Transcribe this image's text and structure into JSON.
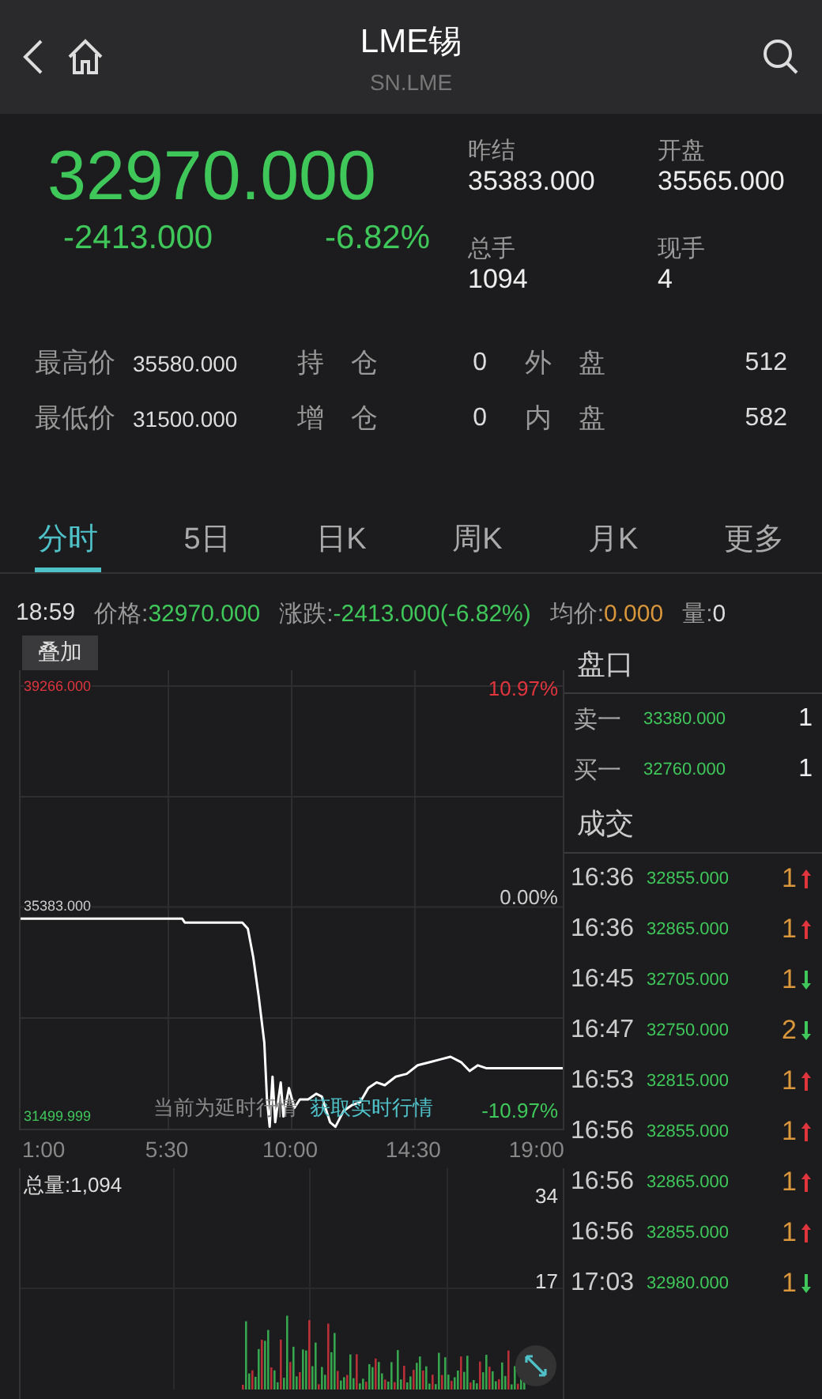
{
  "header": {
    "title": "LME锡",
    "subtitle": "SN.LME"
  },
  "quote": {
    "price": "32970.000",
    "change": "-2413.000",
    "change_pct": "-6.82%",
    "fields": [
      {
        "label": "昨结",
        "value": "35383.000"
      },
      {
        "label": "开盘",
        "value": "35565.000"
      },
      {
        "label": "总手",
        "value": "1094"
      },
      {
        "label": "现手",
        "value": "4"
      }
    ]
  },
  "stats": [
    [
      {
        "label": "最高价",
        "value": "35580.000"
      },
      {
        "label": "持　仓",
        "value": "0"
      },
      {
        "label": "外　盘",
        "value": "512"
      }
    ],
    [
      {
        "label": "最低价",
        "value": "31500.000"
      },
      {
        "label": "增　仓",
        "value": "0"
      },
      {
        "label": "内　盘",
        "value": "582"
      }
    ]
  ],
  "tabs": [
    {
      "label": "分时",
      "selected": true
    },
    {
      "label": "5日",
      "selected": false
    },
    {
      "label": "日K",
      "selected": false
    },
    {
      "label": "周K",
      "selected": false
    },
    {
      "label": "月K",
      "selected": false
    },
    {
      "label": "更多",
      "selected": false
    }
  ],
  "info_line": {
    "time": "18:59",
    "price_label": "价格:",
    "price": "32970.000",
    "change_label": "涨跌:",
    "change": "-2413.000(-6.82%)",
    "avg_label": "均价:",
    "avg": "0.000",
    "vol_label": "量:",
    "vol": "0"
  },
  "chart": {
    "overlay_button": "叠加",
    "top_pct": "10.97%",
    "mid_pct": "0.00%",
    "bottom_pct": "-10.97%",
    "delay_notice": "当前为延时行情",
    "realtime_link": "获取实时行情",
    "volume_label": "总量:1,094",
    "volume_ticks": [
      "34",
      "17"
    ],
    "chart_data": {
      "type": "line",
      "grid": true,
      "x": [
        0.1,
        6,
        6.1,
        8.2,
        8.4,
        8.6,
        8.8,
        9,
        9.1,
        9.2,
        9.3,
        9.4,
        9.6,
        9.7,
        9.9,
        10.1,
        10.3,
        10.6,
        10.9,
        11.1,
        11.4,
        11.6,
        11.9,
        12.2,
        12.5,
        12.8,
        13.1,
        13.4,
        13.8,
        14.2,
        14.6,
        15,
        15.4,
        15.8,
        16.2,
        16.5,
        16.8,
        17.1,
        19.9
      ],
      "series": [
        {
          "color": "#ffffff",
          "values": [
            35180,
            35180,
            35110,
            35110,
            35000,
            34500,
            33800,
            33000,
            32000,
            31520,
            32400,
            31600,
            32300,
            31700,
            32200,
            31850,
            32000,
            32000,
            32100,
            32050,
            31600,
            31520,
            31800,
            31900,
            31950,
            32200,
            32300,
            32250,
            32400,
            32450,
            32600,
            32650,
            32700,
            32750,
            32650,
            32500,
            32600,
            32550,
            32550
          ]
        }
      ],
      "xlim": [
        0.1,
        19.9
      ],
      "ylim": [
        31499.999,
        39266
      ],
      "xticks": [
        {
          "value": 1,
          "label": "1:00"
        },
        {
          "value": 5.5,
          "label": "5:30"
        },
        {
          "value": 10,
          "label": "10:00"
        },
        {
          "value": 14.5,
          "label": "14:30"
        },
        {
          "value": 19,
          "label": "19:00"
        }
      ],
      "yticks": [
        {
          "value": 39266,
          "label": "39266.000"
        },
        {
          "value": 35383,
          "label": "35383.000"
        },
        {
          "value": 31499.999,
          "label": "31499.999"
        }
      ]
    }
  },
  "order_book": {
    "title": "盘口",
    "rows": [
      {
        "label": "卖一",
        "price": "33380.000",
        "qty": "1"
      },
      {
        "label": "买一",
        "price": "32760.000",
        "qty": "1"
      }
    ]
  },
  "trades": {
    "title": "成交",
    "rows": [
      {
        "time": "16:36",
        "price": "32855.000",
        "qty": "1",
        "kind": "up"
      },
      {
        "time": "16:36",
        "price": "32865.000",
        "qty": "1",
        "kind": "up"
      },
      {
        "time": "16:45",
        "price": "32705.000",
        "qty": "1",
        "kind": "down"
      },
      {
        "time": "16:47",
        "price": "32750.000",
        "qty": "2",
        "kind": "down"
      },
      {
        "time": "16:53",
        "price": "32815.000",
        "qty": "1",
        "kind": "up"
      },
      {
        "time": "16:56",
        "price": "32855.000",
        "qty": "1",
        "kind": "up"
      },
      {
        "time": "16:56",
        "price": "32865.000",
        "qty": "1",
        "kind": "up"
      },
      {
        "time": "16:56",
        "price": "32855.000",
        "qty": "1",
        "kind": "up"
      },
      {
        "time": "17:03",
        "price": "32980.000",
        "qty": "1",
        "kind": "down"
      }
    ]
  }
}
